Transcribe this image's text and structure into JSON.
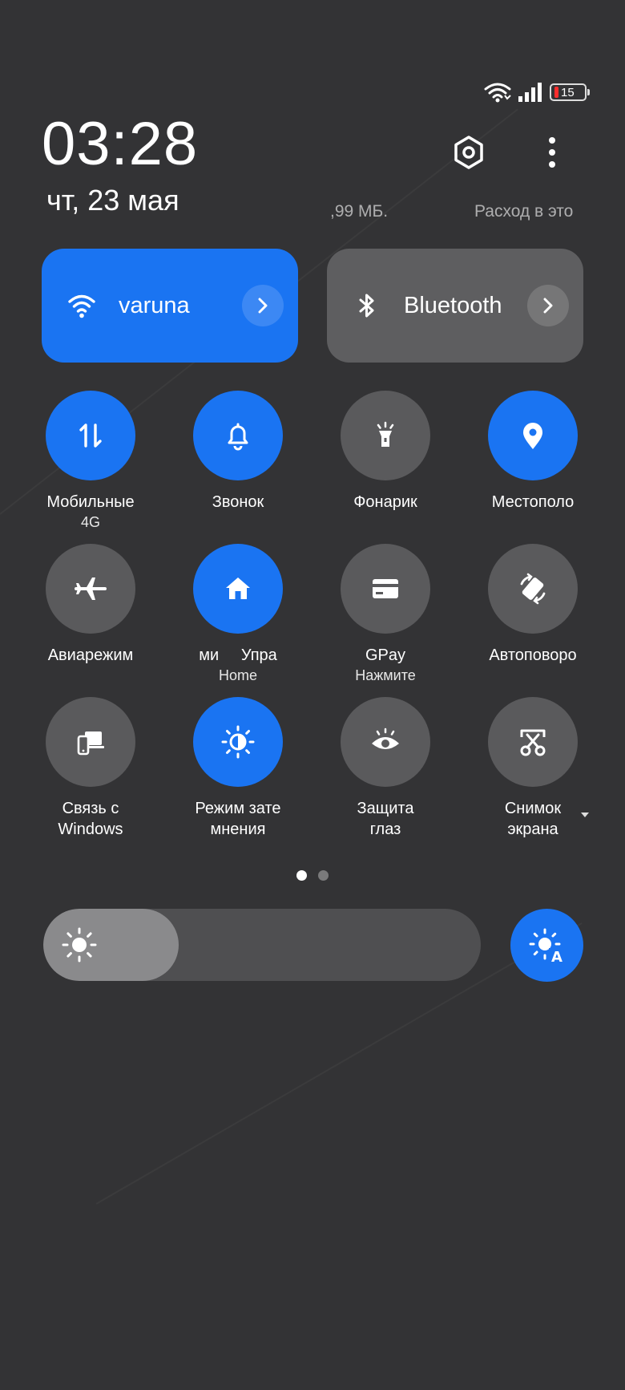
{
  "status": {
    "battery_percent": "15",
    "battery_level": 0.15
  },
  "header": {
    "time": "03:28",
    "date": "чт, 23 мая",
    "usage_amount": ",99 МБ.",
    "usage_label": "Расход в это"
  },
  "big_tiles": [
    {
      "label": "varuna",
      "icon": "wifi-icon",
      "active": true
    },
    {
      "label": "Bluetooth",
      "icon": "bluetooth-icon",
      "active": false
    }
  ],
  "toggles": [
    {
      "label": "Мобильные",
      "sub": "4G",
      "icon": "mobile-data-icon",
      "active": true
    },
    {
      "label": "Звонок",
      "sub": "",
      "icon": "bell-icon",
      "active": true
    },
    {
      "label": "Фонарик",
      "sub": "",
      "icon": "flashlight-icon",
      "active": false
    },
    {
      "label": "Местополо",
      "sub": "",
      "icon": "location-icon",
      "active": true
    },
    {
      "label": "Авиарежим",
      "sub": "",
      "icon": "airplane-icon",
      "active": false
    },
    {
      "label": "ми     Упра",
      "sub": "Home",
      "icon": "home-icon",
      "active": true
    },
    {
      "label": "GPay",
      "sub": "Нажмите",
      "icon": "card-icon",
      "active": false
    },
    {
      "label": "Автоповоро",
      "sub": "",
      "icon": "auto-rotate-icon",
      "active": false
    },
    {
      "label": "Связь с Windows",
      "sub": "",
      "icon": "link-windows-icon",
      "active": false
    },
    {
      "label": "Режим затемнения",
      "sub": "",
      "icon": "dark-mode-icon",
      "active": true
    },
    {
      "label": "Защита глаз",
      "sub": "",
      "icon": "eye-icon",
      "active": false
    },
    {
      "label": "Снимок экрана",
      "sub": "",
      "icon": "screenshot-icon",
      "active": false
    }
  ],
  "pager": {
    "count": 2,
    "active": 0
  },
  "brightness": {
    "level": 0.31
  }
}
